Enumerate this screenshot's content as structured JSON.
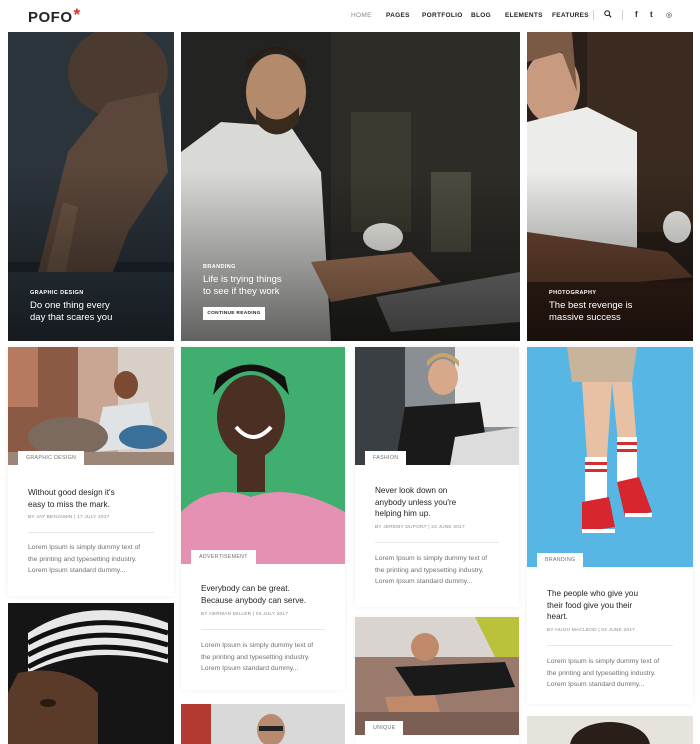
{
  "header": {
    "logo": "POFO",
    "logo_mark": "*",
    "nav": [
      "HOME",
      "PAGES",
      "PORTFOLIO",
      "BLOG",
      "ELEMENTS",
      "FEATURES"
    ],
    "icons": {
      "search": "⚲",
      "facebook": "f",
      "twitter": "t",
      "dribbble": "◎"
    }
  },
  "featured": [
    {
      "category": "GRAPHIC DESIGN",
      "title_line1": "Do one thing every",
      "title_line2": "day that scares you"
    },
    {
      "category": "BRANDING",
      "title_line1": "Life is trying things",
      "title_line2": "to see if they work",
      "button": "CONTINUE READING"
    },
    {
      "category": "PHOTOGRAPHY",
      "title_line1": "The best revenge is",
      "title_line2": "massive success"
    }
  ],
  "posts": [
    {
      "category": "GRAPHIC DESIGN",
      "title_line1": "Without good design it's",
      "title_line2": "easy to miss the mark.",
      "meta": "BY JAY BENJAMIN  |  17 JULY 2017",
      "excerpt": [
        "Lorem Ipsum is simply dummy text of",
        "the printing and typesetting industry.",
        "Lorem Ipsum standard dummy..."
      ]
    },
    {
      "category": "ADVERTISEMENT",
      "title_line1": "Everybody can be great.",
      "title_line2": "Because anybody can serve.",
      "meta": "BY HERMAN MILLER  |  03 JULY 2017",
      "excerpt": [
        "Lorem Ipsum is simply dummy text of",
        "the printing and typesetting industry.",
        "Lorem Ipsum standard dummy..."
      ]
    },
    {
      "category": "FASHION",
      "title_line1": "Never look down on",
      "title_line2": "anybody unless you're",
      "title_line3": "helping him up.",
      "meta": "BY JEREMY DUPONT  |  22 JUNE 2017",
      "excerpt": [
        "Lorem Ipsum is simply dummy text of",
        "the printing and typesetting industry.",
        "Lorem Ipsum standard dummy..."
      ]
    },
    {
      "category": "BRANDING",
      "title_line1": "The people who give you",
      "title_line2": "their food give you their",
      "title_line3": "heart.",
      "meta": "BY HUGH MACLEOD  |  02 JUNE 2017",
      "excerpt": [
        "Lorem Ipsum is simply dummy text of",
        "the printing and typesetting industry.",
        "Lorem Ipsum standard dummy..."
      ]
    },
    {
      "category": "UNIQUE"
    }
  ],
  "colors": {
    "accent": "#e42a2a",
    "text": "#232323",
    "muted": "#6f6f6f",
    "green_bg": "#3fae6e",
    "blue_bg": "#58b6e4"
  }
}
